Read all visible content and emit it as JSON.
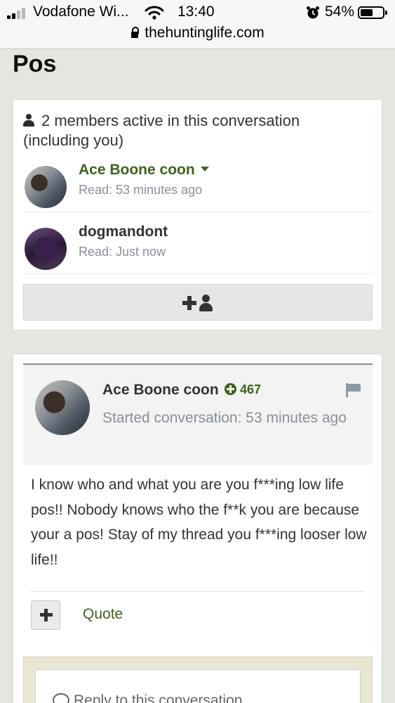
{
  "status_bar": {
    "carrier": "Vodafone Wi...",
    "time": "13:40",
    "battery": "54%",
    "url": "thehuntinglife.com"
  },
  "page": {
    "title": "Pos"
  },
  "members": {
    "heading": "2 members active in this conversation (including you)",
    "items": [
      {
        "name": "Ace Boone coon",
        "read": "Read: 53 minutes ago"
      },
      {
        "name": "dogmandont",
        "read": "Read: Just now"
      }
    ]
  },
  "post": {
    "author": "Ace Boone coon",
    "reputation": "467",
    "started": "Started conversation: 53 minutes ago",
    "body": "I know who and what you are you f***ing low life pos!! Nobody knows who the f**k you are because your a pos! Stay of my thread you f***ing looser low life!!",
    "quote_label": "Quote"
  },
  "reply": {
    "placeholder": "Reply to this conversation..."
  },
  "colors": {
    "accent_green": "#3d6320",
    "page_bg": "#e7e5df",
    "muted_text": "#8a8f96"
  }
}
